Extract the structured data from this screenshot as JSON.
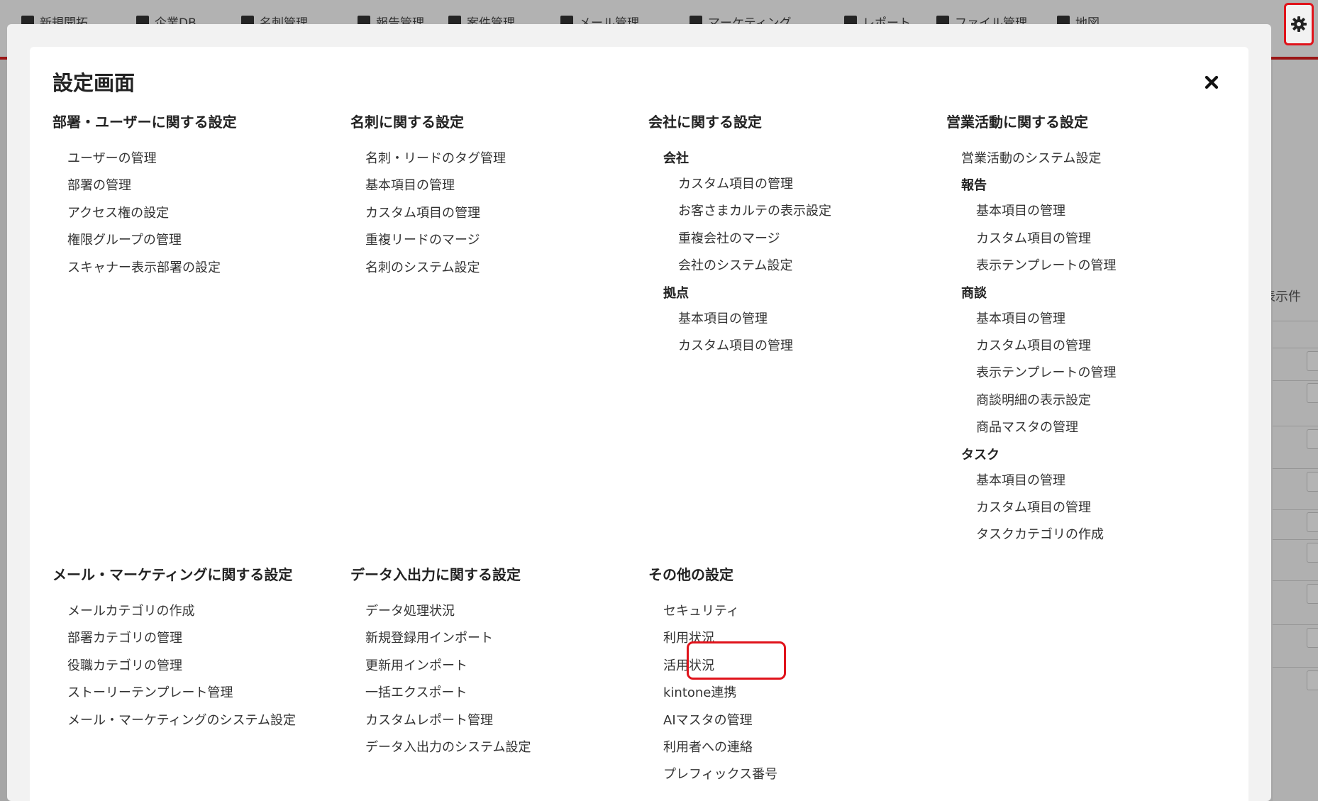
{
  "topnav": {
    "items": [
      {
        "label": "新規開拓",
        "icon": "compass-icon"
      },
      {
        "label": "企業DB",
        "icon": "database-icon"
      },
      {
        "label": "名刺管理",
        "icon": "card-icon"
      },
      {
        "label": "報告管理",
        "icon": "report-icon"
      },
      {
        "label": "案件管理",
        "icon": "briefcase-icon"
      },
      {
        "label": "メール管理",
        "icon": "mail-icon"
      },
      {
        "label": "マーケティング",
        "icon": "megaphone-icon"
      },
      {
        "label": "レポート",
        "icon": "chart-icon"
      },
      {
        "label": "ファイル管理",
        "icon": "folder-icon"
      },
      {
        "label": "地図",
        "icon": "map-icon"
      }
    ],
    "settings_icon": "gear-icon"
  },
  "background": {
    "list_label": "表示件"
  },
  "modal": {
    "title": "設定画面",
    "close_icon": "close-icon",
    "sections": [
      {
        "title": "部署・ユーザーに関する設定",
        "entries": [
          {
            "text": "ユーザーの管理"
          },
          {
            "text": "部署の管理"
          },
          {
            "text": "アクセス権の設定"
          },
          {
            "text": "権限グループの管理"
          },
          {
            "text": "スキャナー表示部署の設定"
          }
        ]
      },
      {
        "title": "名刺に関する設定",
        "entries": [
          {
            "text": "名刺・リードのタグ管理"
          },
          {
            "text": "基本項目の管理"
          },
          {
            "text": "カスタム項目の管理"
          },
          {
            "text": "重複リードのマージ"
          },
          {
            "text": "名刺のシステム設定"
          }
        ]
      },
      {
        "title": "会社に関する設定",
        "entries": [
          {
            "text": "会社",
            "group": true
          },
          {
            "text": "カスタム項目の管理",
            "sub": true
          },
          {
            "text": "お客さまカルテの表示設定",
            "sub": true
          },
          {
            "text": "重複会社のマージ",
            "sub": true
          },
          {
            "text": "会社のシステム設定",
            "sub": true
          },
          {
            "text": "拠点",
            "group": true
          },
          {
            "text": "基本項目の管理",
            "sub": true
          },
          {
            "text": "カスタム項目の管理",
            "sub": true
          }
        ]
      },
      {
        "title": "営業活動に関する設定",
        "entries": [
          {
            "text": "営業活動のシステム設定"
          },
          {
            "text": "報告",
            "group": true
          },
          {
            "text": "基本項目の管理",
            "sub": true
          },
          {
            "text": "カスタム項目の管理",
            "sub": true
          },
          {
            "text": "表示テンプレートの管理",
            "sub": true
          },
          {
            "text": "商談",
            "group": true
          },
          {
            "text": "基本項目の管理",
            "sub": true
          },
          {
            "text": "カスタム項目の管理",
            "sub": true
          },
          {
            "text": "表示テンプレートの管理",
            "sub": true
          },
          {
            "text": "商談明細の表示設定",
            "sub": true
          },
          {
            "text": "商品マスタの管理",
            "sub": true
          },
          {
            "text": "タスク",
            "group": true
          },
          {
            "text": "基本項目の管理",
            "sub": true
          },
          {
            "text": "カスタム項目の管理",
            "sub": true
          },
          {
            "text": "タスクカテゴリの作成",
            "sub": true
          }
        ]
      },
      {
        "title": "メール・マーケティングに関する設定",
        "entries": [
          {
            "text": "メールカテゴリの作成"
          },
          {
            "text": "部署カテゴリの管理"
          },
          {
            "text": "役職カテゴリの管理"
          },
          {
            "text": "ストーリーテンプレート管理"
          },
          {
            "text": "メール・マーケティングのシステム設定"
          }
        ]
      },
      {
        "title": "データ入出力に関する設定",
        "entries": [
          {
            "text": "データ処理状況"
          },
          {
            "text": "新規登録用インポート"
          },
          {
            "text": "更新用インポート"
          },
          {
            "text": "一括エクスポート"
          },
          {
            "text": "カスタムレポート管理"
          },
          {
            "text": "データ入出力のシステム設定"
          }
        ]
      },
      {
        "title": "その他の設定",
        "entries": [
          {
            "text": "セキュリティ"
          },
          {
            "text": "利用状況"
          },
          {
            "text": "活用状況"
          },
          {
            "text": "kintone連携"
          },
          {
            "text": "AIマスタの管理"
          },
          {
            "text": "利用者への連絡"
          },
          {
            "text": "プレフィックス番号"
          }
        ]
      }
    ]
  }
}
